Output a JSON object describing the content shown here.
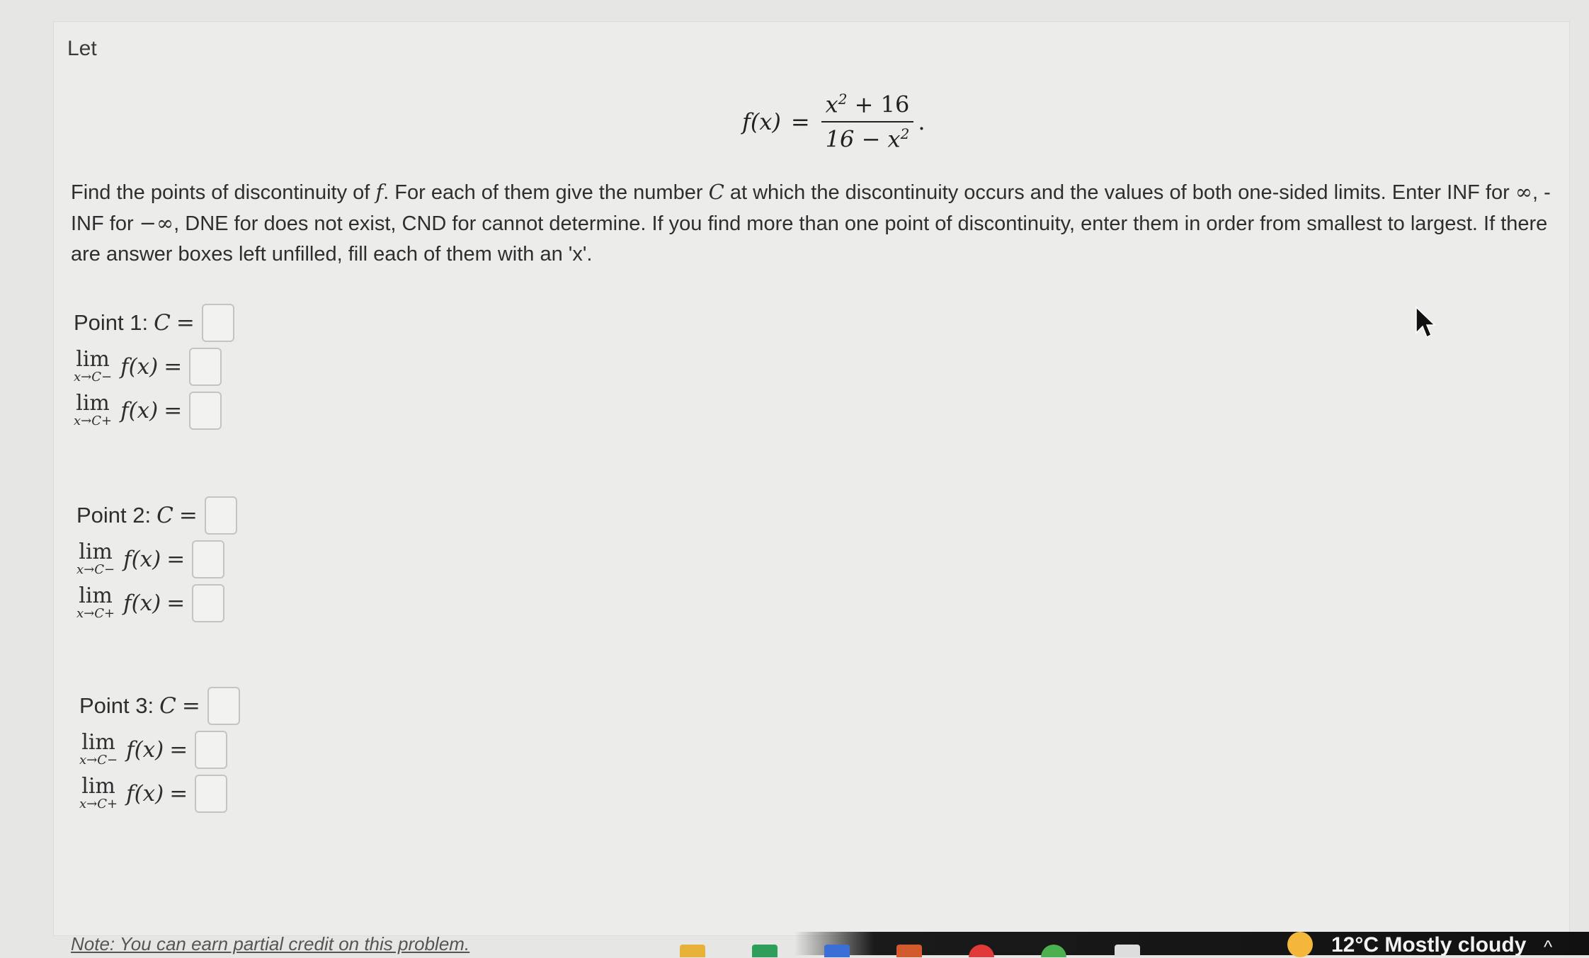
{
  "intro": {
    "let": "Let"
  },
  "formula": {
    "lhs": "f(x)",
    "eq": "=",
    "num_base": "x",
    "num_exp": "2",
    "num_rest": " + 16",
    "den_base": "16 − x",
    "den_exp": "2",
    "end": "."
  },
  "instructions": {
    "p1": "Find the points of discontinuity of ",
    "f": "f",
    "p2": ". For each of them give the number ",
    "C": "C",
    "p3": " at which the discontinuity occurs and the values of both one-sided limits. Enter INF for ",
    "inf": "∞",
    "p4": ", -INF for ",
    "neginf": "−∞",
    "p5": ", DNE for does not exist, CND for cannot determine. If you find more than one point of discontinuity, enter them in order from smallest to largest. If there are answer boxes left unfilled, fill each of them with an 'x'."
  },
  "points": [
    {
      "label": "Point 1:",
      "c": "C",
      "eq": "=",
      "lim": "lim",
      "left_sub": "x→C−",
      "right_sub": "x→C+",
      "fx": "f(x)",
      "eq2": "=",
      "c_value": "",
      "left_value": "",
      "right_value": ""
    },
    {
      "label": "Point 2:",
      "c": "C",
      "eq": "=",
      "lim": "lim",
      "left_sub": "x→C−",
      "right_sub": "x→C+",
      "fx": "f(x)",
      "eq2": "=",
      "c_value": "",
      "left_value": "",
      "right_value": ""
    },
    {
      "label": "Point 3:",
      "c": "C",
      "eq": "=",
      "lim": "lim",
      "left_sub": "x→C−",
      "right_sub": "x→C+",
      "fx": "f(x)",
      "eq2": "=",
      "c_value": "",
      "left_value": "",
      "right_value": ""
    }
  ],
  "note": "Note: You can earn partial credit on this problem.",
  "taskbar": {
    "weather": "12°C  Mostly cloudy"
  },
  "colors": {
    "panel": "#ececea",
    "box_border": "#c4c4c4",
    "taskbar": "#111111"
  }
}
